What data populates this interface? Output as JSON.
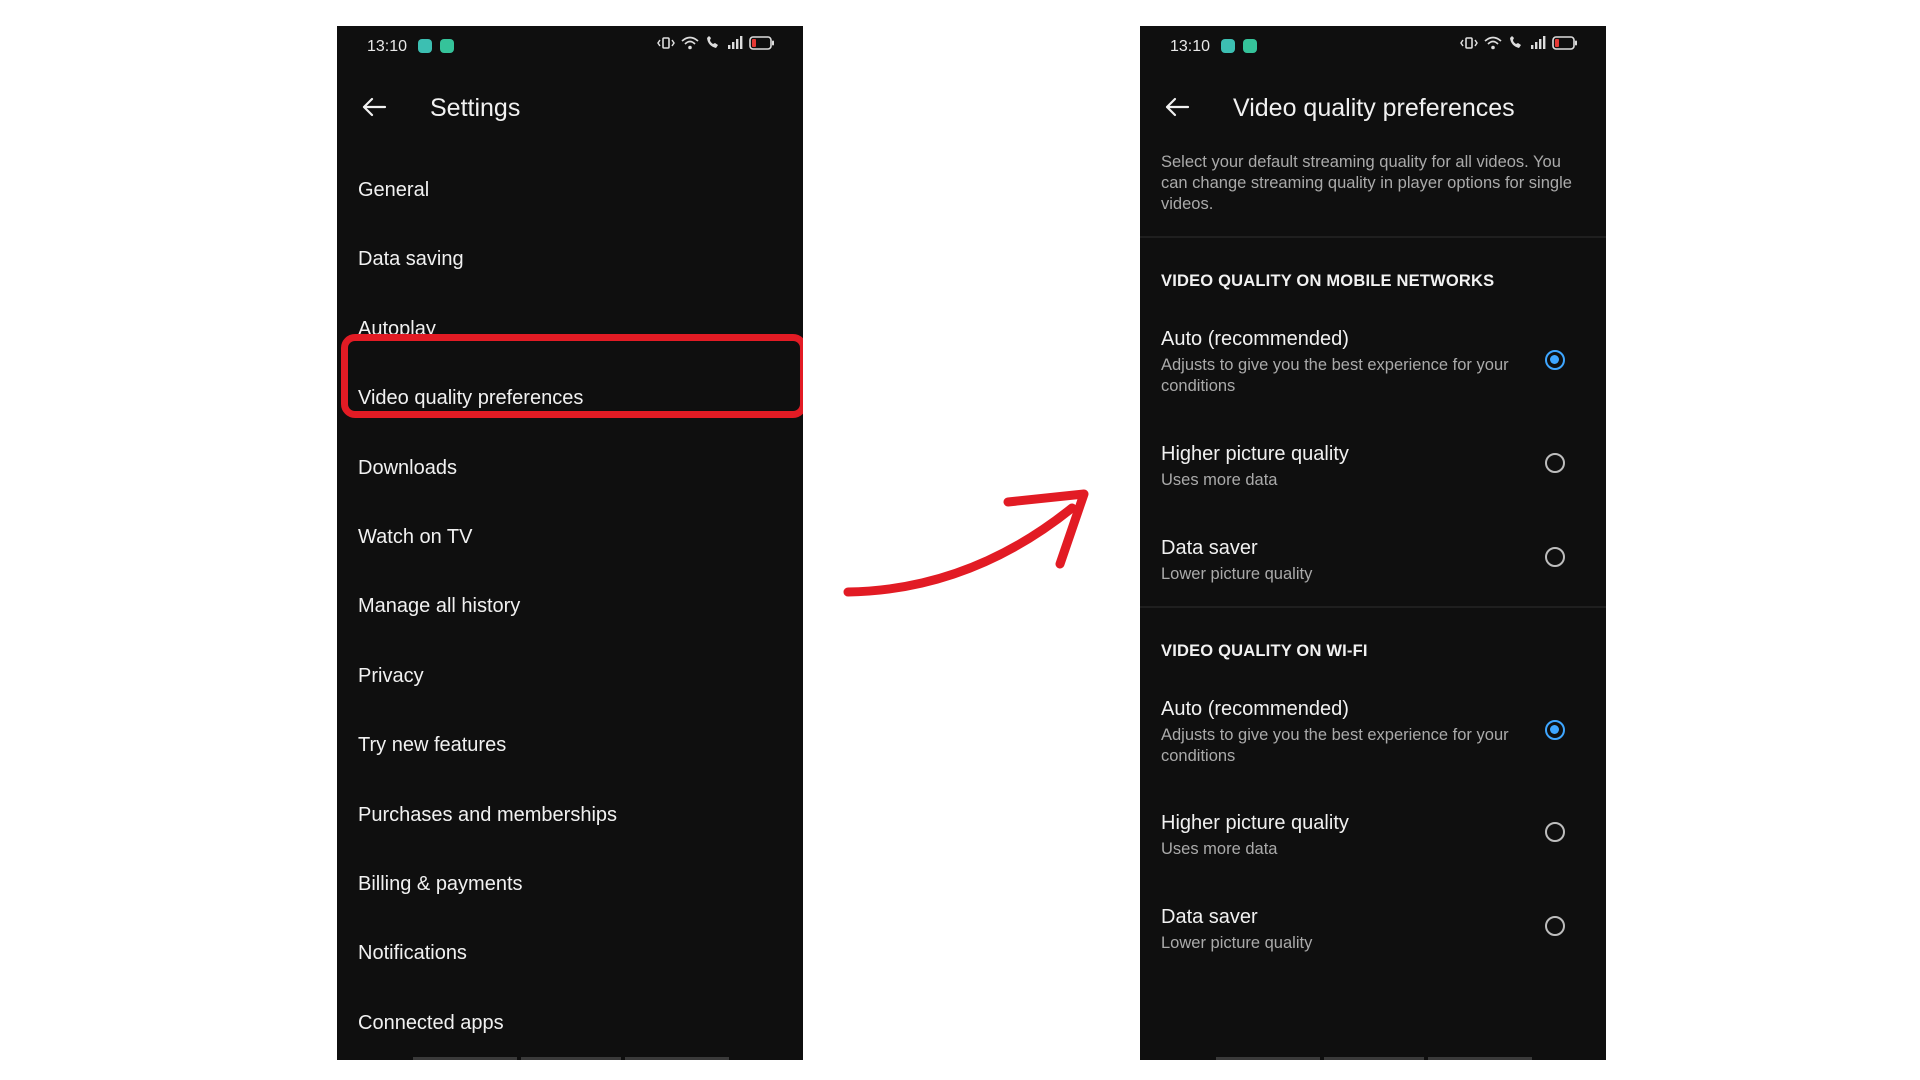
{
  "status_time": "13:10",
  "settings_screen": {
    "title": "Settings",
    "items": [
      "General",
      "Data saving",
      "Autoplay",
      "Video quality preferences",
      "Downloads",
      "Watch on TV",
      "Manage all history",
      "Privacy",
      "Try new features",
      "Purchases and memberships",
      "Billing & payments",
      "Notifications",
      "Connected apps"
    ],
    "highlighted_item": "Video quality preferences",
    "highlight_color": "#e21b24"
  },
  "quality_screen": {
    "title": "Video quality preferences",
    "description": "Select your default streaming quality for all videos. You can change streaming quality in player options for single videos.",
    "mobile": {
      "heading": "VIDEO QUALITY ON MOBILE NETWORKS",
      "options": [
        {
          "title": "Auto (recommended)",
          "subtitle": "Adjusts to give you the best experience for your conditions",
          "selected": true
        },
        {
          "title": "Higher picture quality",
          "subtitle": "Uses more data",
          "selected": false
        },
        {
          "title": "Data saver",
          "subtitle": "Lower picture quality",
          "selected": false
        }
      ]
    },
    "wifi": {
      "heading": "VIDEO QUALITY ON WI-FI",
      "options": [
        {
          "title": "Auto (recommended)",
          "subtitle": "Adjusts to give you the best experience for your conditions",
          "selected": true
        },
        {
          "title": "Higher picture quality",
          "subtitle": "Uses more data",
          "selected": false
        },
        {
          "title": "Data saver",
          "subtitle": "Lower picture quality",
          "selected": false
        }
      ]
    }
  },
  "colors": {
    "background": "#0f0f0f",
    "radio_selected": "#3ea6ff",
    "arrow": "#e21b24"
  },
  "icons": {
    "back": "arrow-left-icon",
    "status": [
      "vibrate-icon",
      "wifi-icon",
      "wifi-call-icon",
      "signal-icon",
      "battery-low-icon"
    ]
  }
}
